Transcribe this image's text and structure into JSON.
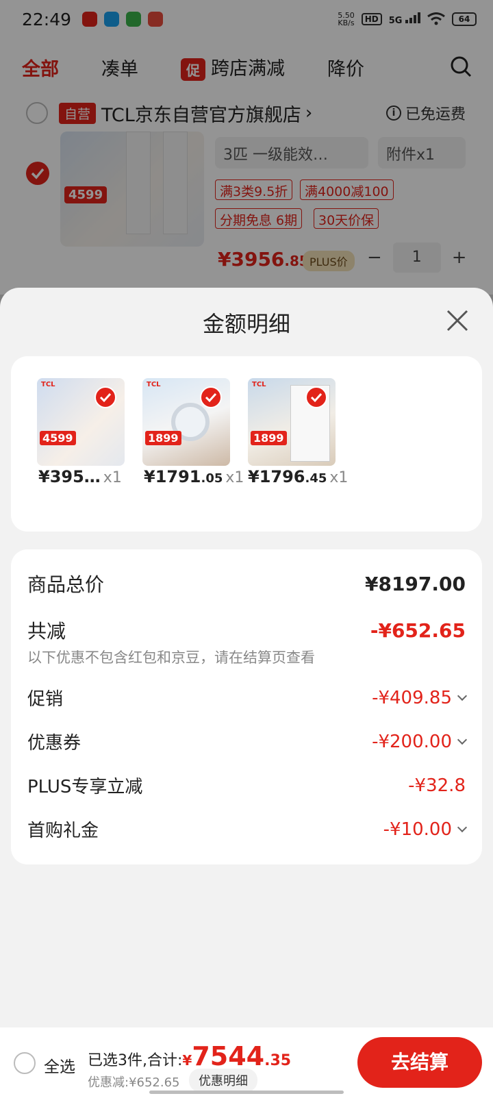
{
  "status_bar": {
    "time": "22:49",
    "speed_value": "5.50",
    "speed_unit": "KB/s",
    "hd": "HD",
    "network": "5G",
    "battery": "64"
  },
  "tabs": [
    {
      "label": "全部",
      "active": true
    },
    {
      "label": "凑单"
    },
    {
      "label": "跨店满减",
      "chip": "促"
    },
    {
      "label": "降价"
    }
  ],
  "store": {
    "badge": "自营",
    "name": "TCL京东自营官方旗舰店",
    "arrow": "›",
    "shipping": "已免运费",
    "info_icon": "i"
  },
  "product": {
    "spec": "3匹 一级能效…",
    "accessory": "附件x1",
    "tags": [
      "满3类9.5折",
      "满4000减100",
      "分期免息 6期",
      "30天价保"
    ],
    "price_int": "¥3956",
    "price_dec": ".85",
    "plus_label": "PLUS价",
    "image_badge": "4599",
    "qty_minus": "−",
    "qty": "1",
    "qty_plus": "+"
  },
  "sheet": {
    "title": "金额明细",
    "items": [
      {
        "price": "¥395…",
        "decimal": "",
        "qty": "x1",
        "img_logo": "TCL",
        "img_badge": "4599"
      },
      {
        "price": "¥1791",
        "decimal": ".05",
        "qty": "x1",
        "img_logo": "TCL",
        "img_badge": "1899"
      },
      {
        "price": "¥1796",
        "decimal": ".45",
        "qty": "x1",
        "img_logo": "TCL",
        "img_badge": "1899"
      }
    ],
    "summary": {
      "total_label": "商品总价",
      "total_value": "¥8197.00",
      "reduce_label": "共减",
      "reduce_value": "-¥652.65",
      "note": "以下优惠不包含红包和京豆，请在结算页查看",
      "lines": [
        {
          "label": "促销",
          "value": "-¥409.85",
          "expandable": true
        },
        {
          "label": "优惠券",
          "value": "-¥200.00",
          "expandable": true
        },
        {
          "label": "PLUS专享立减",
          "value": "-¥32.8",
          "expandable": false
        },
        {
          "label": "首购礼金",
          "value": "-¥10.00",
          "expandable": true
        }
      ]
    }
  },
  "bottom_bar": {
    "select_all": "全选",
    "selected_text": "已选3件,合计:",
    "currency": "¥",
    "total_int": "7544",
    "total_dec": ".35",
    "discount_text": "优惠减:¥652.65",
    "detail_button": "优惠明细",
    "checkout": "去结算"
  },
  "colors": {
    "accent": "#e2231a",
    "sheet_bg": "#f2f2f2"
  }
}
